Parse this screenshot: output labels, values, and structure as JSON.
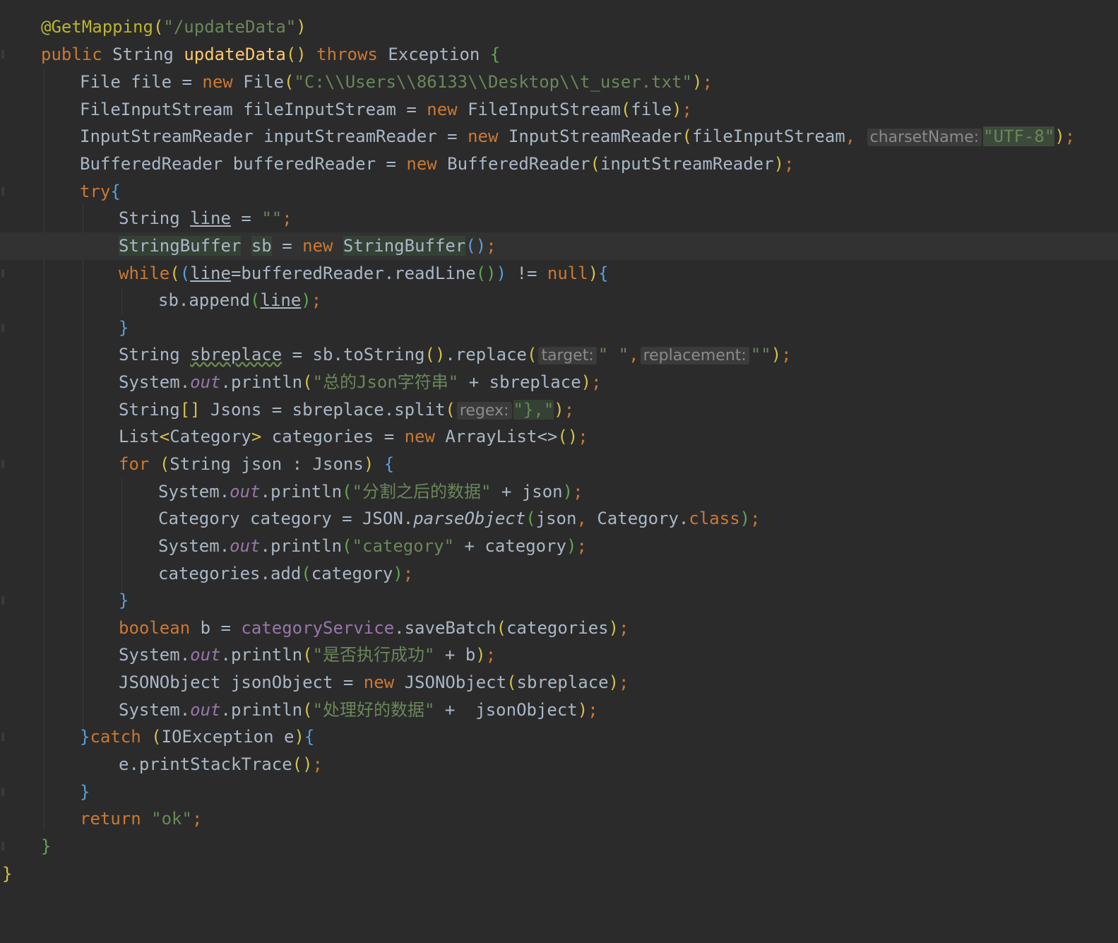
{
  "editor": {
    "annotation": {
      "name": "@GetMapping",
      "path": "\"/updateData\""
    },
    "method": {
      "modifier": "public",
      "return_type": "String",
      "name": "updateData",
      "throws_kw": "throws",
      "exception": "Exception"
    },
    "file_path": "\"C:\\\\Users\\\\86133\\\\Desktop\\\\t_user.txt\"",
    "charset_hint": "charsetName:",
    "charset_value": "\"UTF-8\"",
    "target_hint": "target:",
    "replacement_hint": "replacement:",
    "regex_hint": "regex:",
    "str_space": "\" \"",
    "str_empty": "\"\"",
    "split_regex": "\"},\"",
    "msg_total": "\"总的Json字符串\"",
    "msg_split": "\"分割之后的数据\"",
    "msg_category": "\"category\"",
    "msg_success": "\"是否执行成功\"",
    "msg_processed": "\"处理好的数据\"",
    "return_value": "\"ok\""
  }
}
